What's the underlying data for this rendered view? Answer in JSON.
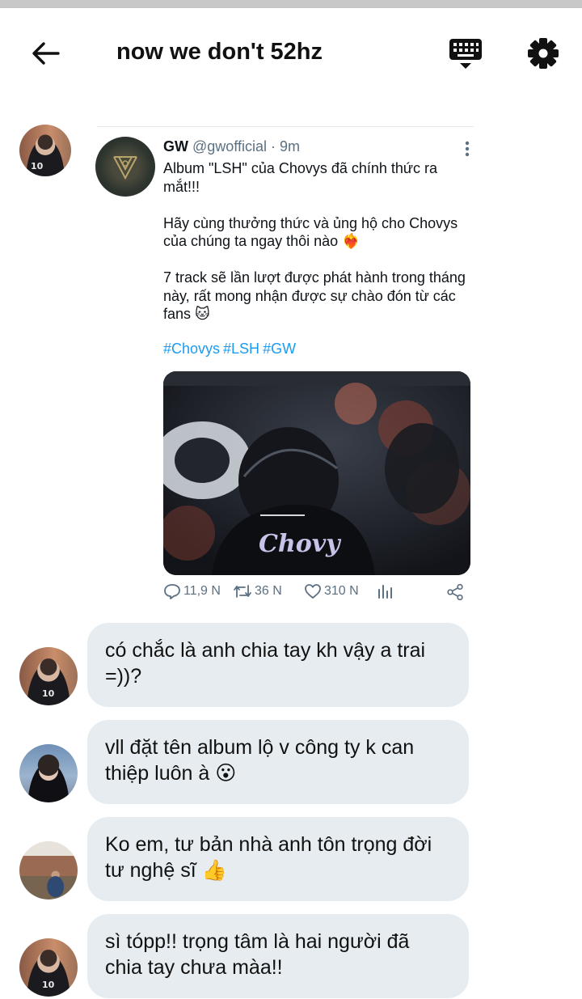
{
  "header": {
    "title": "now we don't 52hz",
    "back_icon": "back-arrow-icon",
    "keyboard_icon": "keyboard-icon",
    "settings_icon": "gear-icon"
  },
  "shared_tweet": {
    "author_name": "GW",
    "author_handle": "@gwofficial",
    "time_meta": "· 9m",
    "text": "Album \"LSH\" của Chovys đã chính thức ra mắt!!!\n\nHãy cùng thưởng thức và ủng hộ cho Chovys của chúng ta ngay thôi nào ❤️‍🔥\n\n7 track sẽ lần lượt được phát hành trong tháng này, rất mong nhận được sự chào đón từ các fans 🐱",
    "hashtags": [
      "#Chovys",
      "#LSH",
      "#GW"
    ],
    "media_jersey_text": "Chovy",
    "stats": {
      "replies": "11,9 N",
      "retweets": "36 N",
      "likes": "310 N"
    }
  },
  "messages": [
    {
      "text": "có chắc là anh chia tay kh vậy a trai =))?"
    },
    {
      "text": "vll đặt tên album lộ v công ty k can thiệp luôn à 😮"
    },
    {
      "text": "Ko em, tư bản nhà anh tôn trọng đời tư nghệ sĩ 👍"
    },
    {
      "text": "sì tópp!! trọng tâm là hai người đã chia tay chưa màa!!"
    }
  ],
  "avatar_jersey_number": "10",
  "colors": {
    "hashtag": "#1d9bf0",
    "bubble": "#e6ecf0",
    "meta_text": "#5b7083"
  }
}
